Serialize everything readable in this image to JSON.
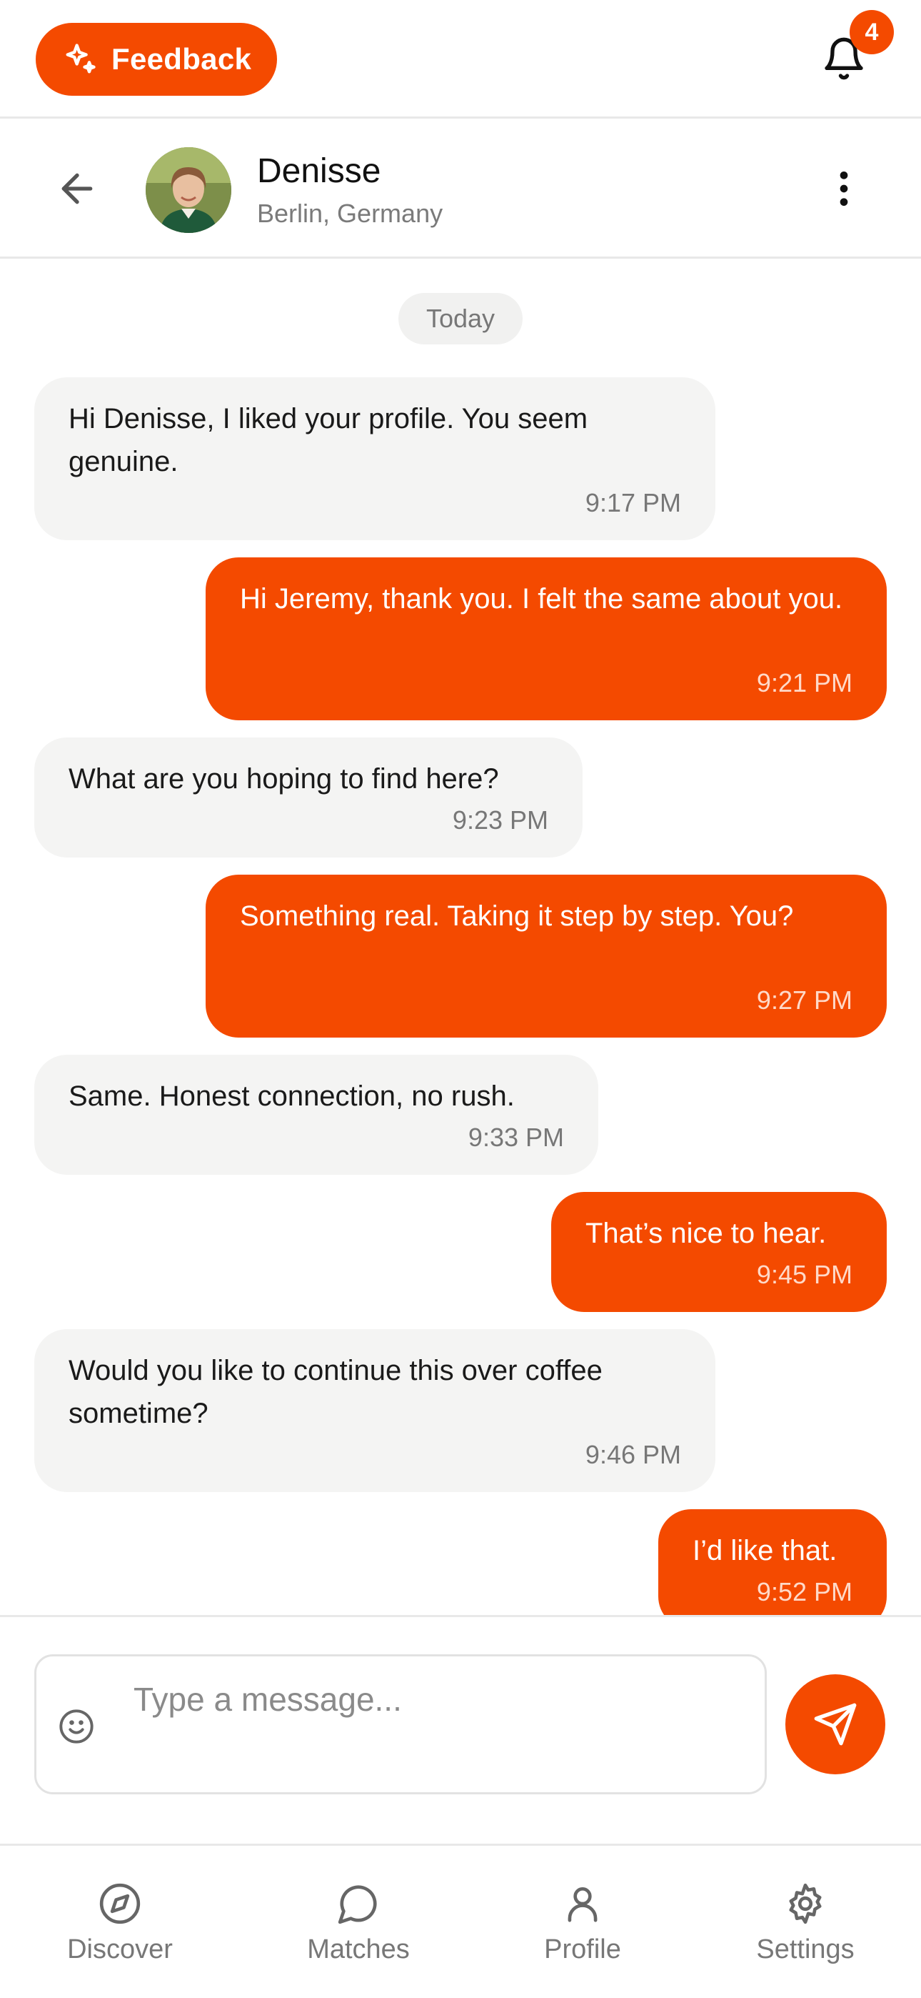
{
  "colors": {
    "accent": "#f44a00",
    "incoming_bubble": "#f4f4f3",
    "muted_text": "#777777",
    "divider": "#e8e8e8"
  },
  "topbar": {
    "feedback_label": "Feedback",
    "feedback_icon": "sparkles-icon",
    "notification_icon": "bell-icon",
    "notification_count": "4"
  },
  "chat_header": {
    "back_icon": "arrow-left-icon",
    "name": "Denisse",
    "location": "Berlin, Germany",
    "menu_icon": "vertical-dots-icon"
  },
  "conversation": {
    "date_label": "Today",
    "messages": [
      {
        "direction": "incoming",
        "text": "Hi Denisse, I liked your profile. You seem genuine.",
        "time": "9:17 PM"
      },
      {
        "direction": "outgoing",
        "text": "Hi Jeremy, thank you. I felt the same about you.",
        "time": "9:21 PM"
      },
      {
        "direction": "incoming",
        "text": "What are you hoping to find here?",
        "time": "9:23 PM"
      },
      {
        "direction": "outgoing",
        "text": "Something real. Taking it step by step. You?",
        "time": "9:27 PM"
      },
      {
        "direction": "incoming",
        "text": "Same. Honest connection, no rush.",
        "time": "9:33 PM"
      },
      {
        "direction": "outgoing",
        "text": "That’s nice to hear.",
        "time": "9:45 PM"
      },
      {
        "direction": "incoming",
        "text": "Would you like to continue this over coffee sometime?",
        "time": "9:46 PM"
      },
      {
        "direction": "outgoing",
        "text": "I’d like that.",
        "time": "9:52 PM"
      }
    ]
  },
  "composer": {
    "emoji_icon": "smiley-icon",
    "placeholder": "Type a message...",
    "value": "",
    "send_icon": "paper-plane-icon"
  },
  "bottom_nav": {
    "items": [
      {
        "label": "Discover",
        "icon": "compass-icon"
      },
      {
        "label": "Matches",
        "icon": "chat-bubble-icon"
      },
      {
        "label": "Profile",
        "icon": "user-icon"
      },
      {
        "label": "Settings",
        "icon": "gear-icon"
      }
    ]
  }
}
